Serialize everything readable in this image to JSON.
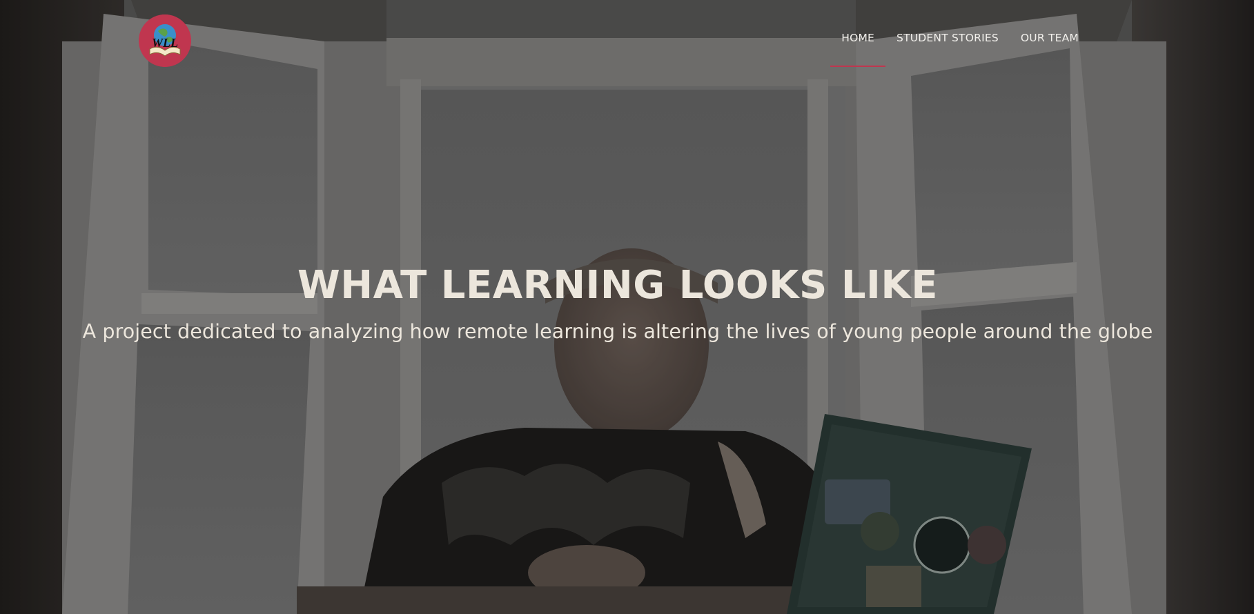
{
  "nav": {
    "items": [
      {
        "label": "HOME",
        "active": true
      },
      {
        "label": "STUDENT STORIES",
        "active": false
      },
      {
        "label": "OUR TEAM",
        "active": false
      }
    ],
    "accent_color": "#c0364f"
  },
  "logo": {
    "icon": "globe-book-logo-icon",
    "text": "WLL"
  },
  "hero": {
    "title": "WHAT LEARNING LOOKS LIKE",
    "subtitle": "A project dedicated to analyzing how remote learning is altering the lives of young people around the globe",
    "text_color": "#ece6dc"
  }
}
